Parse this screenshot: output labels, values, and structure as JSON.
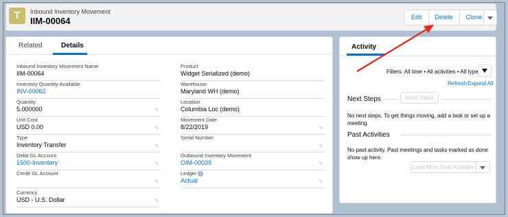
{
  "header": {
    "icon_letter": "T",
    "object_type": "Inbound Inventory Movement",
    "record_name": "IIM-00064",
    "actions": [
      "Edit",
      "Delete",
      "Clone"
    ]
  },
  "tabs": [
    "Related",
    "Details"
  ],
  "fields_left": [
    {
      "label": "Inbound Inventory Movement Name",
      "value": "IIM-00064",
      "link": false,
      "editable": false
    },
    {
      "label": "Inventory Quantity Available",
      "value": "INV-00062",
      "link": true,
      "editable": false
    },
    {
      "label": "Quantity",
      "value": "5.000000",
      "link": false,
      "editable": true
    },
    {
      "label": "Unit Cost",
      "value": "USD 0.00",
      "link": false,
      "editable": true
    },
    {
      "label": "Type",
      "value": "Inventory Transfer",
      "link": false,
      "editable": true
    },
    {
      "label": "Debit GL Account",
      "value": "1500-Inventory",
      "link": true,
      "editable": true
    },
    {
      "label": "Credit GL Account",
      "value": "",
      "link": false,
      "editable": true
    },
    {
      "label": "Currency",
      "value": "USD - U.S. Dollar",
      "link": false,
      "editable": true
    }
  ],
  "fields_right": [
    {
      "label": "Product",
      "value": "Widget Serialized (demo)",
      "link": false,
      "editable": false
    },
    {
      "label": "Warehouse",
      "value": "Maryland WH (demo)",
      "link": false,
      "editable": false
    },
    {
      "label": "Location",
      "value": "Columbia Loc (demo)",
      "link": false,
      "editable": false
    },
    {
      "label": "Movement Date",
      "value": "8/22/2019",
      "link": false,
      "editable": true
    },
    {
      "label": "Serial Number",
      "value": "",
      "link": false,
      "editable": true
    },
    {
      "label": "Outbound Inventory Movement",
      "value": "OIM-00039",
      "link": true,
      "editable": true
    },
    {
      "label": "Ledger",
      "value": "Actual",
      "link": true,
      "editable": true,
      "info": true
    }
  ],
  "activity": {
    "tab": "Activity",
    "filters": "Filters: All time • All activities • All types",
    "refresh": "Refresh",
    "expand_all": "Expand All",
    "next_steps_title": "Next Steps",
    "more_steps": "More Steps",
    "next_steps_desc": "No next steps. To get things moving, add a task or set up a meeting.",
    "past_title": "Past Activities",
    "past_desc": "No past activity. Past meetings and tasks marked as done show up here.",
    "load_more": "Load More Past Activities"
  },
  "icons": [
    "pencil-icon",
    "filter-icon",
    "chevron-down-icon",
    "info-icon"
  ],
  "colors": {
    "link": "#0070d2",
    "icon_bg": "#c8bd6a",
    "annotation": "#e8281c"
  }
}
